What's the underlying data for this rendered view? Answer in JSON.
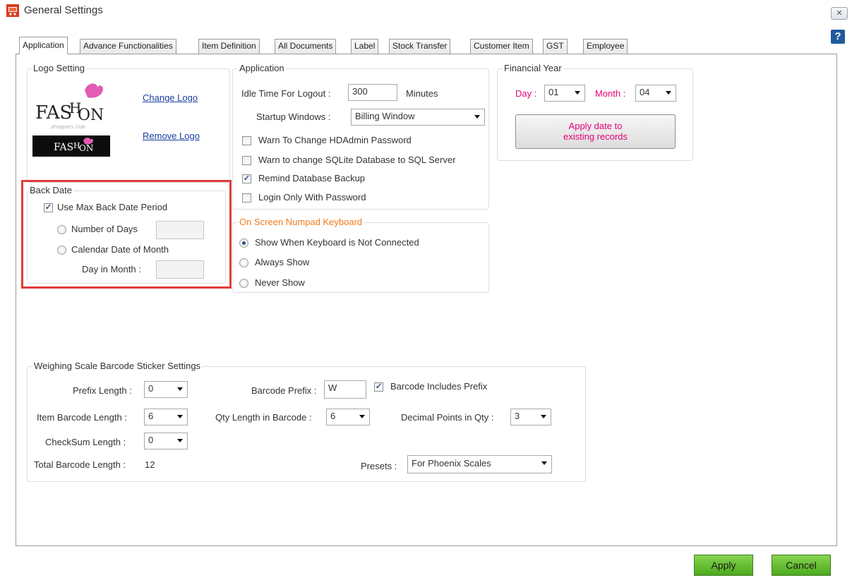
{
  "window": {
    "title": "General Settings",
    "close_glyph": "✕",
    "help_glyph": "?"
  },
  "tabs": [
    {
      "label": "Application"
    },
    {
      "label": "Advance Functionalities"
    },
    {
      "label": "Item Definition"
    },
    {
      "label": "All Documents"
    },
    {
      "label": "Label"
    },
    {
      "label": "Stock Transfer"
    },
    {
      "label": "Customer Item"
    },
    {
      "label": "GST"
    },
    {
      "label": "Employee"
    }
  ],
  "logo_setting": {
    "legend": "Logo Setting",
    "change_logo": "Change Logo",
    "remove_logo": "Remove Logo",
    "logo_text": "FASHION",
    "logo_subtext": "shoppers club"
  },
  "back_date": {
    "legend": "Back Date",
    "use_max_label": "Use Max Back Date Period",
    "use_max_checked": true,
    "number_of_days_label": "Number of Days",
    "calendar_date_label": "Calendar Date of Month",
    "day_in_month_label": "Day in Month :"
  },
  "application": {
    "legend": "Application",
    "idle_label": "Idle Time For Logout :",
    "idle_value": "300",
    "idle_unit": "Minutes",
    "startup_label": "Startup Windows :",
    "startup_value": "Billing Window",
    "checks": [
      {
        "label": "Warn To Change HDAdmin Password",
        "checked": false
      },
      {
        "label": "Warn to change SQLite Database to SQL Server",
        "checked": false
      },
      {
        "label": "Remind Database Backup",
        "checked": true
      },
      {
        "label": "Login Only With Password",
        "checked": false
      }
    ]
  },
  "numpad": {
    "legend": "On Screen Numpad Keyboard",
    "options": [
      {
        "label": "Show When Keyboard is Not Connected",
        "selected": true
      },
      {
        "label": "Always Show",
        "selected": false
      },
      {
        "label": "Never Show",
        "selected": false
      }
    ]
  },
  "financial_year": {
    "legend": "Financial Year",
    "day_label": "Day :",
    "day_value": "01",
    "month_label": "Month :",
    "month_value": "04",
    "apply_button_line1": "Apply date to",
    "apply_button_line2": "existing records"
  },
  "weighing": {
    "legend": "Weighing Scale Barcode Sticker Settings",
    "prefix_length_label": "Prefix Length :",
    "prefix_length_value": "0",
    "barcode_prefix_label": "Barcode Prefix :",
    "barcode_prefix_value": "W",
    "includes_prefix_label": "Barcode Includes Prefix",
    "includes_prefix_checked": true,
    "item_barcode_length_label": "Item Barcode Length :",
    "item_barcode_length_value": "6",
    "qty_length_label": "Qty Length in Barcode :",
    "qty_length_value": "6",
    "decimal_points_label": "Decimal Points in Qty :",
    "decimal_points_value": "3",
    "checksum_length_label": "CheckSum Length :",
    "checksum_length_value": "0",
    "total_length_label": "Total Barcode Length :",
    "total_length_value": "12",
    "presets_label": "Presets :",
    "presets_value": "For Phoenix Scales"
  },
  "footer": {
    "apply": "Apply",
    "cancel": "Cancel"
  },
  "colors": {
    "accent_orange": "#f07b1e",
    "link_blue": "#1a3e9e",
    "apply_green": "#5cb82e",
    "highlight_red": "#e23b3b"
  }
}
